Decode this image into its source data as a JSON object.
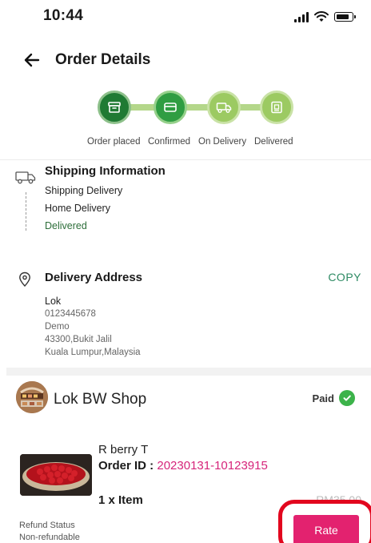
{
  "status_bar": {
    "time": "10:44"
  },
  "header": {
    "title": "Order Details",
    "back_icon": "arrow-left-icon"
  },
  "progress": {
    "steps": [
      {
        "label": "Order placed",
        "icon": "box-icon",
        "state": "completed"
      },
      {
        "label": "Confirmed",
        "icon": "card-icon",
        "state": "completed"
      },
      {
        "label": "On Delivery",
        "icon": "truck-icon",
        "state": "completed"
      },
      {
        "label": "Delivered",
        "icon": "delivered-package-icon",
        "state": "completed"
      }
    ]
  },
  "shipping": {
    "title": "Shipping Information",
    "lines": [
      "Shipping Delivery",
      "Home Delivery"
    ],
    "status": "Delivered"
  },
  "address": {
    "title": "Delivery Address",
    "copy_label": "COPY",
    "name": "Lok",
    "lines": [
      "0123445678",
      "Demo",
      "43300,Bukit Jalil",
      "Kuala Lumpur,Malaysia"
    ]
  },
  "shop": {
    "name": "Lok BW Shop",
    "payment_status": "Paid"
  },
  "product": {
    "name": "R berry T",
    "order_id_label": "Order ID :",
    "order_id": "20230131-10123915",
    "quantity": "1 x Item",
    "price": "RM35.00"
  },
  "refund": {
    "label": "Refund Status",
    "value": "Non-refundable"
  },
  "actions": {
    "rate_label": "Rate"
  },
  "colors": {
    "accent_green": "#2f9d42",
    "pink": "#e3226f",
    "highlight_red": "#e2061e",
    "order_id_color": "#d6247a"
  }
}
